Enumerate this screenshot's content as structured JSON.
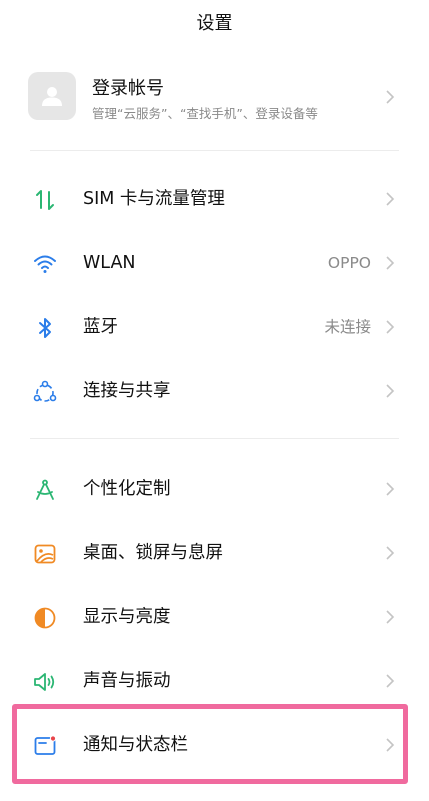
{
  "header": {
    "title": "设置"
  },
  "account": {
    "title": "登录帐号",
    "subtitle": "管理“云服务”、“查找手机”、登录设备等",
    "avatar_icon": "person-icon"
  },
  "groups": [
    {
      "items": [
        {
          "id": "sim",
          "label": "SIM 卡与流量管理",
          "value": "",
          "icon": "sim-data-icon"
        },
        {
          "id": "wlan",
          "label": "WLAN",
          "value": "OPPO",
          "icon": "wifi-icon"
        },
        {
          "id": "bluetooth",
          "label": "蓝牙",
          "value": "未连接",
          "icon": "bluetooth-icon"
        },
        {
          "id": "connection",
          "label": "连接与共享",
          "value": "",
          "icon": "share-connection-icon"
        }
      ]
    },
    {
      "items": [
        {
          "id": "personalize",
          "label": "个性化定制",
          "value": "",
          "icon": "compass-icon"
        },
        {
          "id": "wallpaper",
          "label": "桌面、锁屏与息屏",
          "value": "",
          "icon": "wallpaper-icon"
        },
        {
          "id": "display",
          "label": "显示与亮度",
          "value": "",
          "icon": "brightness-icon"
        },
        {
          "id": "sound",
          "label": "声音与振动",
          "value": "",
          "icon": "speaker-icon"
        },
        {
          "id": "notification",
          "label": "通知与状态栏",
          "value": "",
          "icon": "notification-icon"
        }
      ]
    }
  ],
  "colors": {
    "green": "#2bb673",
    "blue": "#2b7de9",
    "orange": "#f08a24",
    "highlight": "#f06a9e",
    "chevron": "#c4c4c4"
  }
}
